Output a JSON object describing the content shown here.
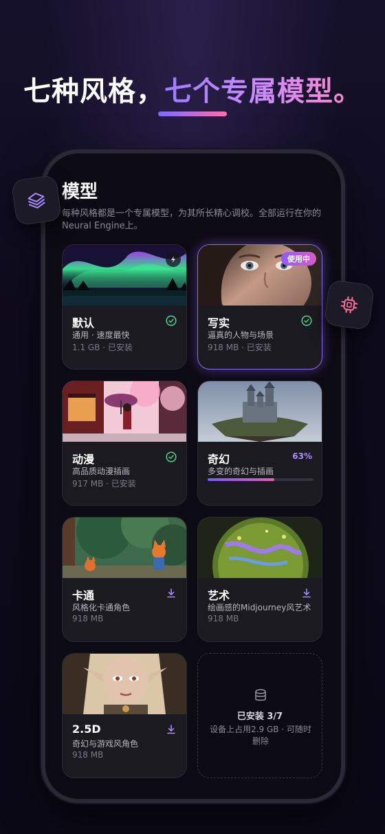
{
  "headline": {
    "part1": "七种风格，",
    "part2": "七个专属模型。"
  },
  "screen": {
    "title": "模型",
    "description": "每种风格都是一个专属模型，为其所长精心调校。全部运行在你的Neural Engine上。"
  },
  "cards": [
    {
      "name": "默认",
      "sub": "通用 · 速度最快",
      "meta": "1.1 GB · 已安装",
      "status": "installed",
      "icon": "bolt-icon"
    },
    {
      "name": "写实",
      "sub": "逼真的人物与场景",
      "meta": "918 MB · 已安装",
      "status": "installed",
      "badge": "使用中"
    },
    {
      "name": "动漫",
      "sub": "高品质动漫插画",
      "meta": "917 MB · 已安装",
      "status": "installed"
    },
    {
      "name": "奇幻",
      "sub": "多变的奇幻与插画",
      "status": "downloading",
      "progress_label": "63%",
      "progress": 0.63
    },
    {
      "name": "卡通",
      "sub": "风格化卡通角色",
      "meta": "918 MB",
      "status": "download"
    },
    {
      "name": "艺术",
      "sub": "绘画感的Midjourney风艺术",
      "meta": "918 MB",
      "status": "download"
    },
    {
      "name": "2.5D",
      "sub": "奇幻与游戏风角色",
      "meta": "918 MB",
      "status": "download"
    }
  ],
  "summary": {
    "title": "已安装 3/7",
    "description": "设备上占用2.9 GB · 可随时删除"
  },
  "colors": {
    "accent": "#8b6cf0",
    "installed": "#4fd18b",
    "download": "#a98cff",
    "pill": "#c45cd6"
  },
  "icons": {
    "badge_left": "layers-icon",
    "badge_right": "chip-icon",
    "summary": "database-icon"
  }
}
